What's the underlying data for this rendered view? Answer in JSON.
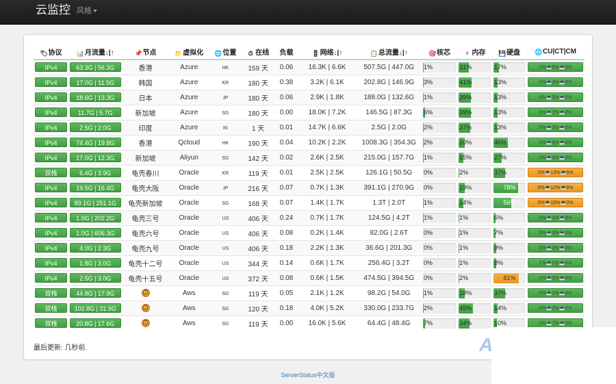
{
  "navbar": {
    "brand": "云监控",
    "style_menu": "风格"
  },
  "table": {
    "headers": {
      "protocol": "协议",
      "monthly": "月流量↓|↑",
      "node": "节点",
      "virt": "虚拟化",
      "location": "位置",
      "uptime": "在线",
      "load": "负载",
      "network": "网络↓|↑",
      "total": "总流量↓|↑",
      "cpu": "核芯",
      "mem": "内存",
      "disk": "硬盘",
      "cuctcm": "CU|CT|CM"
    },
    "rows": [
      {
        "protocol": "IPv4",
        "monthly": "63.3G | 56.3G",
        "node": "香港",
        "virt": "Azure",
        "loc": "HK",
        "uptime": "159 天",
        "load": "0.06",
        "net": "16.3K | 6.6K",
        "total": "507.5G | 447.0G",
        "cpu": {
          "label": "1%",
          "pct": 1
        },
        "mem": {
          "label": "31%",
          "pct": 31
        },
        "disk": {
          "label": "17%",
          "pct": 17
        },
        "cc": "0%💻5%💻0%"
      },
      {
        "protocol": "IPv4",
        "monthly": "17.0G | 11.5G",
        "node": "韩国",
        "virt": "Azure",
        "loc": "KR",
        "uptime": "180 天",
        "load": "0.38",
        "net": "3.2K | 6.1K",
        "total": "202.8G | 146.9G",
        "cpu": {
          "label": "3%",
          "pct": 3
        },
        "mem": {
          "label": "41%",
          "pct": 41
        },
        "disk": {
          "label": "13%",
          "pct": 13
        },
        "cc": "0%💻3%💻0%"
      },
      {
        "protocol": "IPv4",
        "monthly": "18.6G | 13.3G",
        "node": "日本",
        "virt": "Azure",
        "loc": "JP",
        "uptime": "180 天",
        "load": "0.06",
        "net": "2.9K | 1.8K",
        "total": "188.0G | 132.6G",
        "cpu": {
          "label": "1%",
          "pct": 1
        },
        "mem": {
          "label": "39%",
          "pct": 39
        },
        "disk": {
          "label": "13%",
          "pct": 13
        },
        "cc": "0%💻5%💻0%"
      },
      {
        "protocol": "IPv4",
        "monthly": "11.7G | 5.7G",
        "node": "新加坡",
        "virt": "Azure",
        "loc": "SG",
        "uptime": "180 天",
        "load": "0.00",
        "net": "18.0K | 7.2K",
        "total": "146.5G | 87.3G",
        "cpu": {
          "label": "6%",
          "pct": 6
        },
        "mem": {
          "label": "39%",
          "pct": 39
        },
        "disk": {
          "label": "13%",
          "pct": 13
        },
        "cc": "0%💻7%💻0%"
      },
      {
        "protocol": "IPv4",
        "monthly": "2.5G | 2.0G",
        "node": "印度",
        "virt": "Azure",
        "loc": "IN",
        "uptime": "1 天",
        "load": "0.01",
        "net": "14.7K | 6.6K",
        "total": "2.5G | 2.0G",
        "cpu": {
          "label": "2%",
          "pct": 2
        },
        "mem": {
          "label": "37%",
          "pct": 37
        },
        "disk": {
          "label": "13%",
          "pct": 13
        },
        "cc": "0%💻3%💻0%"
      },
      {
        "protocol": "IPv4",
        "monthly": "74.4G | 19.8G",
        "node": "香港",
        "virt": "Qcloud",
        "loc": "HK",
        "uptime": "190 天",
        "load": "0.04",
        "net": "10.2K | 2.2K",
        "total": "1008.3G | 354.3G",
        "cpu": {
          "label": "2%",
          "pct": 2
        },
        "mem": {
          "label": "20%",
          "pct": 20
        },
        "disk": {
          "label": "46%",
          "pct": 46
        },
        "cc": "0%💻5%💻0%"
      },
      {
        "protocol": "IPv4",
        "monthly": "17.0G | 12.3G",
        "node": "新加坡",
        "virt": "Aliyun",
        "loc": "SG",
        "uptime": "142 天",
        "load": "0.02",
        "net": "2.6K | 2.5K",
        "total": "215.0G | 157.7G",
        "cpu": {
          "label": "1%",
          "pct": 1
        },
        "mem": {
          "label": "15%",
          "pct": 15
        },
        "disk": {
          "label": "27%",
          "pct": 27
        },
        "cc": "0%💻0%💻3%"
      },
      {
        "protocol": "双栈",
        "monthly": "6.4G | 3.9G",
        "node": "龟壳春川",
        "virt": "Oracle",
        "loc": "KR",
        "uptime": "119 天",
        "load": "0.01",
        "net": "2.5K | 2.5K",
        "total": "126.1G | 50.5G",
        "cpu": {
          "label": "0%",
          "pct": 0
        },
        "mem": {
          "label": "2%",
          "pct": 2
        },
        "disk": {
          "label": "37%",
          "pct": 37
        },
        "cc": "0%💻13%💻6%",
        "cc_warn": true
      },
      {
        "protocol": "IPv4",
        "monthly": "19.5G | 16.4G",
        "node": "龟壳大阪",
        "virt": "Oracle",
        "loc": "JP",
        "uptime": "216 天",
        "load": "0.07",
        "net": "0.7K | 1.3K",
        "total": "391.1G | 270.9G",
        "cpu": {
          "label": "0%",
          "pct": 0
        },
        "mem": {
          "label": "19%",
          "pct": 19
        },
        "disk": {
          "label": "78%",
          "pct": 78
        },
        "cc": "0%💻12%💻8%",
        "cc_warn": true
      },
      {
        "protocol": "IPv4",
        "monthly": "89.1G | 251.1G",
        "node": "龟壳新加坡",
        "virt": "Oracle",
        "loc": "SG",
        "uptime": "168 天",
        "load": "0.07",
        "net": "1.4K | 1.7K",
        "total": "1.3T | 2.0T",
        "cpu": {
          "label": "1%",
          "pct": 1
        },
        "mem": {
          "label": "14%",
          "pct": 14
        },
        "disk": {
          "label": "56%",
          "pct": 56
        },
        "cc": "0%💻15%💻0%",
        "cc_warn": true
      },
      {
        "protocol": "IPv4",
        "monthly": "1.0G | 202.2G",
        "node": "龟壳三号",
        "virt": "Oracle",
        "loc": "US",
        "uptime": "406 天",
        "load": "0.24",
        "net": "0.7K | 1.7K",
        "total": "124.5G | 4.2T",
        "cpu": {
          "label": "1%",
          "pct": 1
        },
        "mem": {
          "label": "1%",
          "pct": 1
        },
        "disk": {
          "label": "6%",
          "pct": 6
        },
        "cc": "0%💻0%💻0%"
      },
      {
        "protocol": "IPv4",
        "monthly": "1.0G | 606.3G",
        "node": "龟壳六号",
        "virt": "Oracle",
        "loc": "US",
        "uptime": "406 天",
        "load": "0.08",
        "net": "0.2K | 1.4K",
        "total": "82.0G | 2.6T",
        "cpu": {
          "label": "0%",
          "pct": 0
        },
        "mem": {
          "label": "1%",
          "pct": 1
        },
        "disk": {
          "label": "7%",
          "pct": 7
        },
        "cc": "0%💻0%💻0%"
      },
      {
        "protocol": "IPv4",
        "monthly": "4.0G | 2.3G",
        "node": "龟壳九号",
        "virt": "Oracle",
        "loc": "US",
        "uptime": "406 天",
        "load": "0.18",
        "net": "2.2K | 1.3K",
        "total": "36.6G | 201.3G",
        "cpu": {
          "label": "0%",
          "pct": 0
        },
        "mem": {
          "label": "1%",
          "pct": 1
        },
        "disk": {
          "label": "9%",
          "pct": 9
        },
        "cc": "0%💻0%💻0%"
      },
      {
        "protocol": "IPv4",
        "monthly": "1.8G | 3.0G",
        "node": "龟壳十二号",
        "virt": "Oracle",
        "loc": "US",
        "uptime": "344 天",
        "load": "0.14",
        "net": "0.6K | 1.7K",
        "total": "256.4G | 3.2T",
        "cpu": {
          "label": "0%",
          "pct": 0
        },
        "mem": {
          "label": "1%",
          "pct": 1
        },
        "disk": {
          "label": "8%",
          "pct": 8
        },
        "cc": "1%💻0%💻0%"
      },
      {
        "protocol": "IPv4",
        "monthly": "2.5G | 3.0G",
        "node": "龟壳十五号",
        "virt": "Oracle",
        "loc": "US",
        "uptime": "372 天",
        "load": "0.08",
        "net": "0.6K | 1.5K",
        "total": "474.5G | 394.5G",
        "cpu": {
          "label": "0%",
          "pct": 0
        },
        "mem": {
          "label": "2%",
          "pct": 2
        },
        "disk": {
          "label": "81%",
          "pct": 81,
          "warn": true
        },
        "cc": "0%💻0%💻0%"
      },
      {
        "protocol": "双栈",
        "monthly": "44.8G | 17.9G",
        "node_icon": "lion-icon",
        "virt": "Aws",
        "loc": "SG",
        "uptime": "119 天",
        "load": "0.05",
        "net": "2.1K | 1.2K",
        "total": "98.2G | 54.0G",
        "cpu": {
          "label": "1%",
          "pct": 1
        },
        "mem": {
          "label": "18%",
          "pct": 18
        },
        "disk": {
          "label": "37%",
          "pct": 37
        },
        "cc": "0%💻2%💻0%"
      },
      {
        "protocol": "双栈",
        "monthly": "102.8G | 31.9G",
        "node_icon": "lion-icon",
        "virt": "Aws",
        "loc": "SG",
        "uptime": "120 天",
        "load": "0.18",
        "net": "4.0K | 5.2K",
        "total": "330.0G | 233.7G",
        "cpu": {
          "label": "2%",
          "pct": 2
        },
        "mem": {
          "label": "45%",
          "pct": 45
        },
        "disk": {
          "label": "14%",
          "pct": 14
        },
        "cc": "0%💻2%💻0%"
      },
      {
        "protocol": "双栈",
        "monthly": "20.8G | 17.6G",
        "node_icon": "lion-icon",
        "virt": "Aws",
        "loc": "SG",
        "uptime": "119 天",
        "load": "0.00",
        "net": "16.0K | 5.6K",
        "total": "64.4G | 48.4G",
        "cpu": {
          "label": "7%",
          "pct": 7
        },
        "mem": {
          "label": "34%",
          "pct": 34
        },
        "disk": {
          "label": "10%",
          "pct": 10
        },
        "cc": "0%💻7%💻0%"
      }
    ]
  },
  "last_update": "最后更新: 几秒前.",
  "footer": "ServerStatus中文版",
  "watermark": "A",
  "colors": {
    "green": "#5cb85c",
    "orange": "#f0ad4e",
    "nav": "#222222",
    "link": "#337ab7"
  }
}
